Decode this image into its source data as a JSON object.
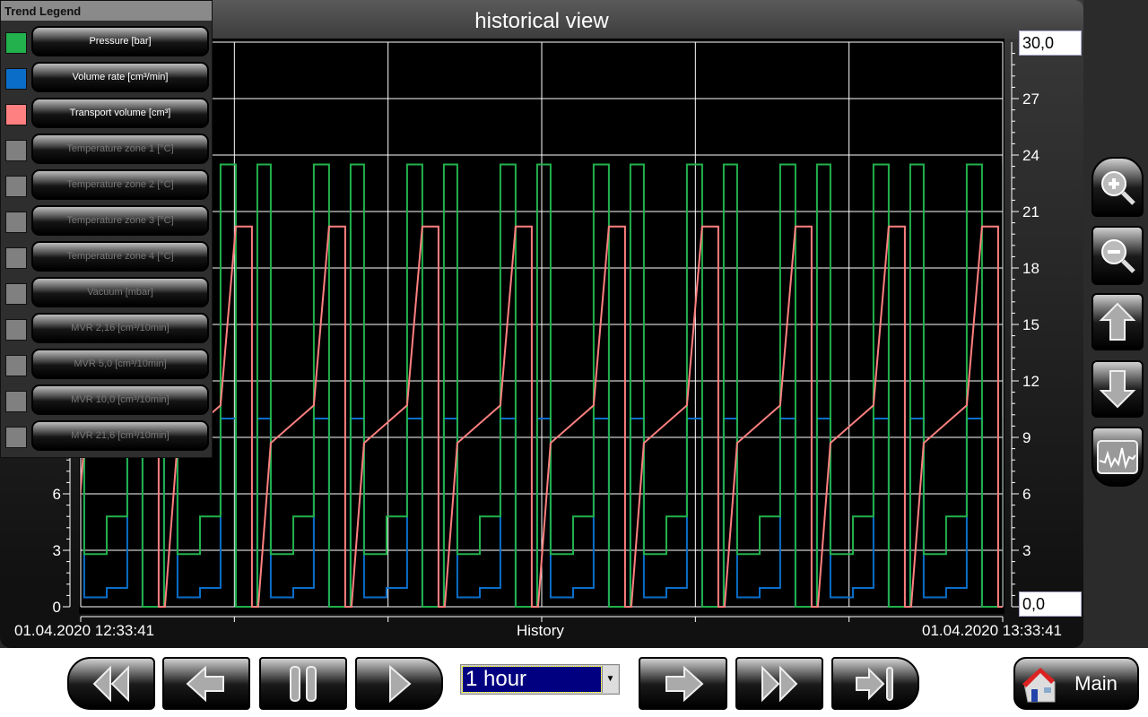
{
  "title": "historical view",
  "legend": {
    "title": "Trend Legend",
    "items": [
      {
        "label": "Pressure [bar]",
        "color": "#22b14c",
        "active": true
      },
      {
        "label": "Volume rate [cm³/min]",
        "color": "#0a6ec8",
        "active": true
      },
      {
        "label": "Transport volume [cm³]",
        "color": "#ff8080",
        "active": true
      },
      {
        "label": "Temperature zone 1 [°C]",
        "color": "#808080",
        "active": false
      },
      {
        "label": "Temperature zone 2 [°C]",
        "color": "#808080",
        "active": false
      },
      {
        "label": "Temperature zone 3 [°C]",
        "color": "#808080",
        "active": false
      },
      {
        "label": "Temperature zone 4 [°C]",
        "color": "#808080",
        "active": false
      },
      {
        "label": "Vacuum [mbar]",
        "color": "#808080",
        "active": false
      },
      {
        "label": "MVR 2,16 [cm³/10min]",
        "color": "#808080",
        "active": false
      },
      {
        "label": "MVR 5,0 [cm³/10min]",
        "color": "#808080",
        "active": false
      },
      {
        "label": "MVR 10,0 [cm³/10min]",
        "color": "#808080",
        "active": false
      },
      {
        "label": "MVR 21,6 [cm³/10min]",
        "color": "#808080",
        "active": false
      }
    ]
  },
  "axis": {
    "y_max_box": "30,0",
    "y_min_box": "0,0",
    "x_start": "01.04.2020 12:33:41",
    "x_center": "History",
    "x_end": "01.04.2020 13:33:41"
  },
  "chart_data": {
    "type": "line",
    "xlim_minutes": [
      0,
      60
    ],
    "ylim": [
      0,
      30
    ],
    "yticks": [
      0,
      3,
      6,
      9,
      12,
      15,
      18,
      21,
      24,
      27,
      30
    ],
    "left_yticks_visible": [
      "0",
      "3",
      "6"
    ],
    "right_yticks": [
      "3",
      "6",
      "9",
      "12",
      "15",
      "18",
      "21",
      "24",
      "27"
    ],
    "grid": true,
    "cycle_period_min": 6.07,
    "first_cycle_start_min": -1.0,
    "series": [
      {
        "name": "Pressure [bar]",
        "color": "#22b14c",
        "cycle_profile": [
          [
            0,
            0
          ],
          [
            0.35,
            0
          ],
          [
            0.35,
            23.5
          ],
          [
            1.23,
            23.5
          ],
          [
            1.23,
            2.8
          ],
          [
            2.69,
            2.8
          ],
          [
            2.69,
            4.8
          ],
          [
            4.03,
            4.8
          ],
          [
            4.03,
            23.5
          ],
          [
            5.02,
            23.5
          ],
          [
            5.02,
            0
          ],
          [
            6.07,
            0
          ]
        ]
      },
      {
        "name": "Volume rate [cm³/min]",
        "color": "#0a6ec8",
        "cycle_profile": [
          [
            0,
            0
          ],
          [
            0.35,
            0
          ],
          [
            0.35,
            10
          ],
          [
            1.23,
            10
          ],
          [
            1.23,
            0.5
          ],
          [
            2.69,
            0.5
          ],
          [
            2.69,
            1.0
          ],
          [
            4.03,
            1.0
          ],
          [
            4.03,
            10
          ],
          [
            5.02,
            10
          ],
          [
            5.02,
            0
          ],
          [
            6.07,
            0
          ]
        ]
      },
      {
        "name": "Transport volume [cm³]",
        "color": "#ff8080",
        "cycle_profile": [
          [
            0,
            0
          ],
          [
            0.41,
            0
          ],
          [
            1.23,
            8.7
          ],
          [
            4.03,
            10.7
          ],
          [
            5.02,
            20.2
          ],
          [
            6.07,
            20.2
          ],
          [
            6.07,
            0
          ]
        ]
      }
    ]
  },
  "controls": {
    "timespan": "1 hour",
    "main_label": "Main"
  }
}
